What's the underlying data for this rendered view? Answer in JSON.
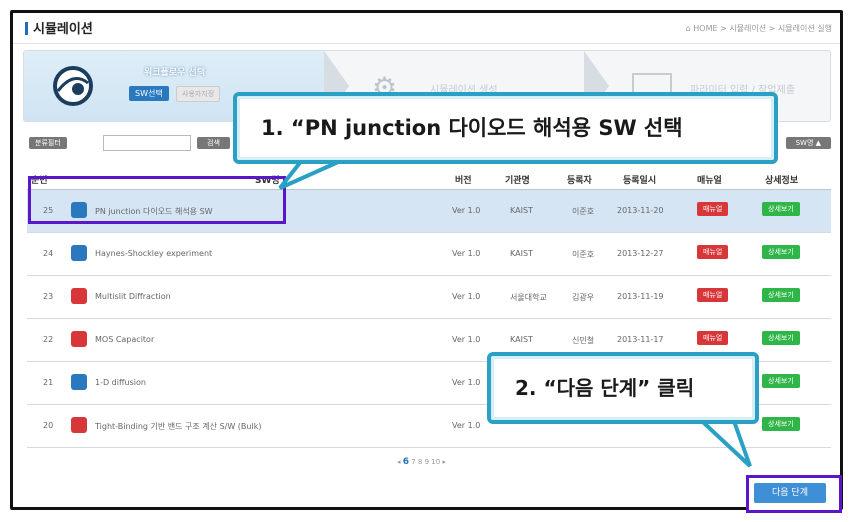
{
  "page": {
    "title": "시뮬레이션",
    "breadcrumb": "HOME > 시뮬레이션 > 시뮬레이션 실행"
  },
  "steps": {
    "step1_title": "워크플로우 선택",
    "sw_select": "SW선택",
    "user_specified": "사용자지정",
    "step2_title": "시뮬레이션 생성",
    "step3_title": "파라미터 입력 / 작업제출"
  },
  "filter": {
    "label": "분류필터",
    "search": "검색",
    "sort": "SW명 ▲"
  },
  "table": {
    "headers": {
      "no": "순번",
      "name": "SW명",
      "version": "버전",
      "org": "기관명",
      "registrant": "등록자",
      "date": "등록일시",
      "manual": "매뉴얼",
      "detail": "상세정보"
    },
    "rows": [
      {
        "no": "25",
        "icon": "blue",
        "name": "PN junction 다이오드 해석용 SW",
        "version": "Ver 1.0",
        "org": "KAIST",
        "registrant": "이준호",
        "date": "2013-11-20",
        "manual": "매뉴얼",
        "detail": "상세보기"
      },
      {
        "no": "24",
        "icon": "blue",
        "name": "Haynes-Shockley experiment",
        "version": "Ver 1.0",
        "org": "KAIST",
        "registrant": "이준호",
        "date": "2013-12-27",
        "manual": "매뉴얼",
        "detail": "상세보기"
      },
      {
        "no": "23",
        "icon": "red",
        "name": "Multislit Diffraction",
        "version": "Ver 1.0",
        "org": "서울대학교",
        "registrant": "김광우",
        "date": "2013-11-19",
        "manual": "매뉴얼",
        "detail": "상세보기"
      },
      {
        "no": "22",
        "icon": "red",
        "name": "MOS Capacitor",
        "version": "Ver 1.0",
        "org": "KAIST",
        "registrant": "신민철",
        "date": "2013-11-17",
        "manual": "매뉴얼",
        "detail": "상세보기"
      },
      {
        "no": "21",
        "icon": "blue",
        "name": "1-D diffusion",
        "version": "Ver 1.0",
        "org": "",
        "registrant": "",
        "date": "",
        "manual": "",
        "detail": "상세보기"
      },
      {
        "no": "20",
        "icon": "red",
        "name": "Tight-Binding 기반 밴드 구조 계산 S/W (Bulk)",
        "version": "Ver 1.0",
        "org": "",
        "registrant": "",
        "date": "",
        "manual": "",
        "detail": "상세보기"
      }
    ]
  },
  "pagination": {
    "current": "6",
    "pages": "7 8 9 10"
  },
  "next_button": "다음 단계",
  "callouts": {
    "one": "1. “PN junction 다이오드 해석용 SW 선택",
    "two": "2. “다음 단계” 클릭"
  },
  "colors": {
    "highlight": "#5a17c9",
    "callout_border": "#2aa1c4",
    "blue_icon": "#2a79bf",
    "red_icon": "#d8373a",
    "manual": "#d8373a",
    "detail": "#2fb548"
  }
}
